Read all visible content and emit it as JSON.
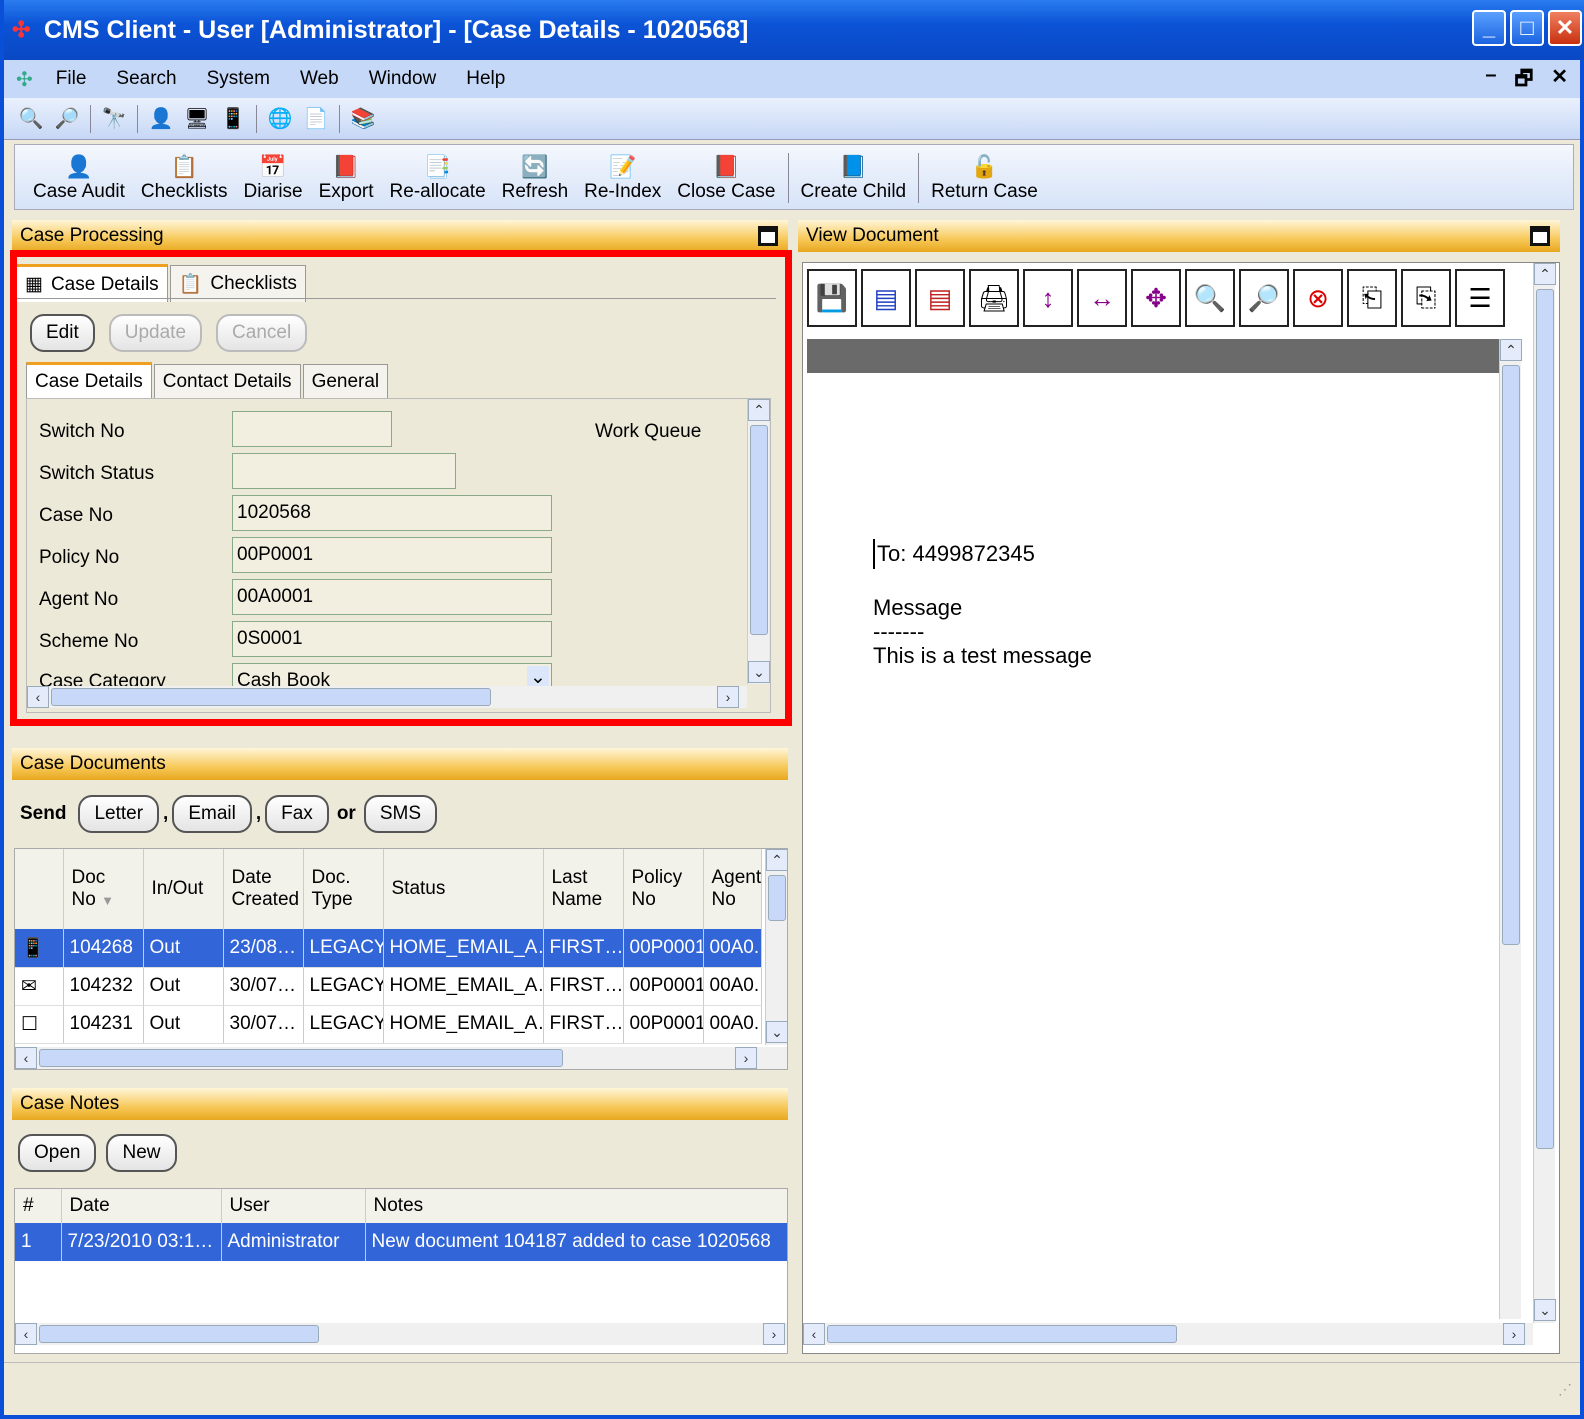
{
  "window": {
    "title": "CMS Client - User [Administrator] - [Case Details - 1020568]"
  },
  "menu": [
    "File",
    "Search",
    "System",
    "Web",
    "Window",
    "Help"
  ],
  "mdi_controls": [
    "–",
    "🗗",
    "✕"
  ],
  "toolbar_icons": [
    "find-case-icon",
    "search-case-icon",
    "binoculars-icon",
    "user-icon",
    "monitor-icon",
    "phone-icon",
    "globe-icon",
    "form-icon",
    "books-icon"
  ],
  "actions": [
    {
      "label": "Case Audit",
      "icon": "👤"
    },
    {
      "label": "Checklists",
      "icon": "📋"
    },
    {
      "label": "Diarise",
      "icon": "📅"
    },
    {
      "label": "Export",
      "icon": "📕"
    },
    {
      "label": "Re-allocate",
      "icon": "📑"
    },
    {
      "label": "Refresh",
      "icon": "🔄"
    },
    {
      "label": "Re-Index",
      "icon": "📝"
    },
    {
      "label": "Close Case",
      "icon": "📕"
    },
    {
      "label": "Create Child",
      "icon": "📘"
    },
    {
      "label": "Return Case",
      "icon": "🔓"
    }
  ],
  "case_processing": {
    "header": "Case Processing",
    "tabs": [
      "Case Details",
      "Checklists"
    ],
    "buttons": {
      "edit": "Edit",
      "update": "Update",
      "cancel": "Cancel"
    },
    "subtabs": [
      "Case Details",
      "Contact Details",
      "General"
    ],
    "fields": {
      "switch_no": {
        "label": "Switch No",
        "value": ""
      },
      "switch_status": {
        "label": "Switch Status",
        "value": ""
      },
      "case_no": {
        "label": "Case No",
        "value": "1020568"
      },
      "policy_no": {
        "label": "Policy No",
        "value": "00P0001"
      },
      "agent_no": {
        "label": "Agent No",
        "value": "00A0001"
      },
      "scheme_no": {
        "label": "Scheme No",
        "value": "0S0001"
      },
      "case_category": {
        "label": "Case Category",
        "value": "Cash Book"
      }
    },
    "work_queue_label": "Work Queue"
  },
  "case_documents": {
    "header": "Case Documents",
    "send_label": "Send",
    "or_label": "or",
    "send_buttons": [
      "Letter",
      "Email",
      "Fax",
      "SMS"
    ],
    "columns": [
      "",
      "Doc No",
      "In/Out",
      "Date Created",
      "Doc. Type",
      "Status",
      "Last Name",
      "Policy No",
      "Agent No"
    ],
    "rows": [
      {
        "icon": "phone-icon",
        "cells": [
          "104268",
          "Out",
          "23/08…",
          "LEGACY",
          "HOME_EMAIL_A…",
          "FIRST…",
          "00P0001",
          "00A0."
        ]
      },
      {
        "icon": "email-icon",
        "cells": [
          "104232",
          "Out",
          "30/07…",
          "LEGACY",
          "HOME_EMAIL_A…",
          "FIRST…",
          "00P0001",
          "00A0."
        ]
      },
      {
        "icon": "document-icon",
        "cells": [
          "104231",
          "Out",
          "30/07…",
          "LEGACY",
          "HOME_EMAIL_A…",
          "FIRST…",
          "00P0001",
          "00A0."
        ]
      }
    ]
  },
  "case_notes": {
    "header": "Case Notes",
    "buttons": [
      "Open",
      "New"
    ],
    "columns": [
      "#",
      "Date",
      "User",
      "Notes"
    ],
    "rows": [
      [
        "1",
        "7/23/2010 03:1…",
        "Administrator",
        "New document 104187 added to case 1020568"
      ]
    ]
  },
  "view_document": {
    "header": "View Document",
    "tools": [
      "save-icon",
      "blue-doc-icon",
      "red-doc-icon",
      "print-icon",
      "fit-height-icon",
      "fit-width-icon",
      "fit-page-icon",
      "zoom-in-icon",
      "zoom-text-icon",
      "zoom-cancel-icon",
      "page-prev-icon",
      "page-next-icon",
      "page-list-icon"
    ],
    "to_line": "To: 4499872345",
    "message_label": "Message",
    "dashes": "-------",
    "body": "This is a test message"
  }
}
